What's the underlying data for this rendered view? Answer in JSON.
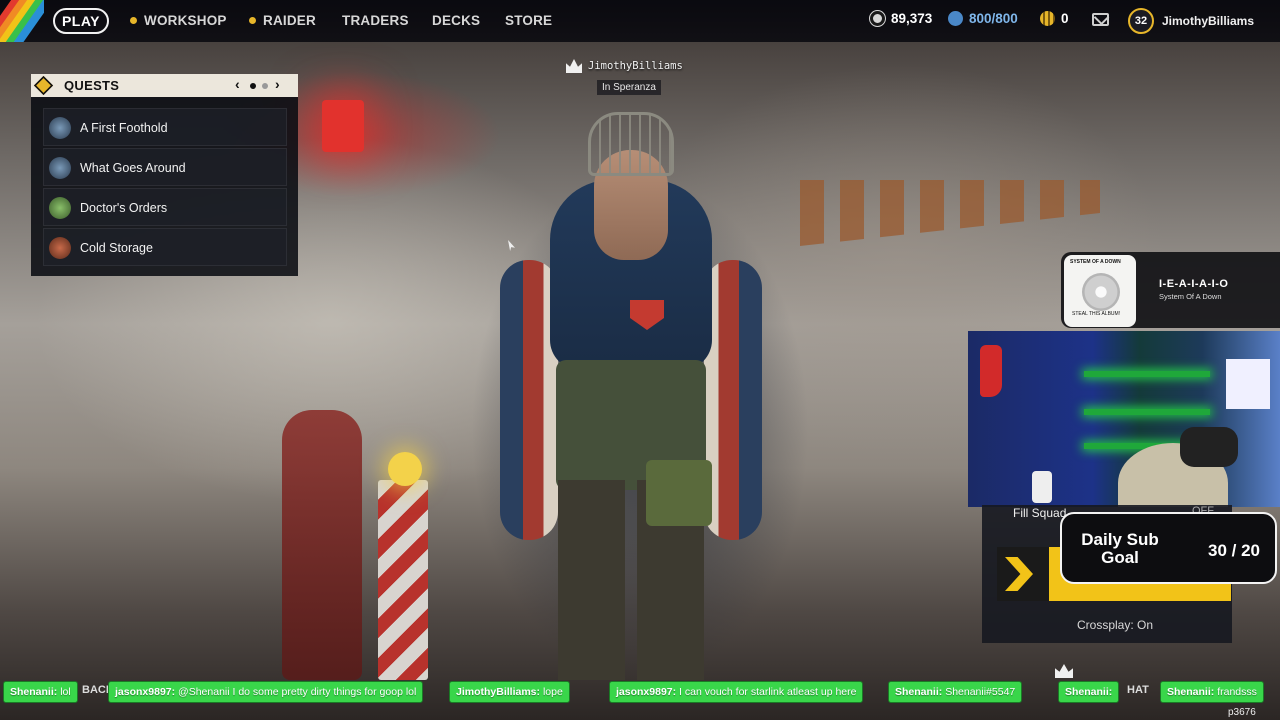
{
  "nav": {
    "play": "PLAY",
    "items": [
      "WORKSHOP",
      "RAIDER",
      "TRADERS",
      "DECKS",
      "STORE"
    ],
    "currency_coins": "89,373",
    "currency_raider": "800/800",
    "currency_tokens": "0",
    "level": "32",
    "username": "JimothyBilliams"
  },
  "quests": {
    "title": "QUESTS",
    "pager_prev": "‹",
    "pager_next": "›",
    "items": [
      {
        "label": "A First Foothold"
      },
      {
        "label": "What Goes Around"
      },
      {
        "label": "Doctor's Orders"
      },
      {
        "label": "Cold Storage"
      }
    ]
  },
  "player_tag": {
    "name": "JimothyBilliams",
    "location": "In Speranza"
  },
  "music": {
    "track": "I-E-A-I-A-I-O",
    "artist": "System Of A Down",
    "album_top": "SYSTEM OF A DOWN",
    "album_bottom": "STEAL THIS ALBUM!"
  },
  "squad": {
    "fill_label": "Fill Squad",
    "fill_state": "OFF",
    "crossplay": "Crossplay: On"
  },
  "sub_goal": {
    "title": "Daily Sub Goal",
    "count": "30 / 20"
  },
  "chat": [
    {
      "user": "Shenanii:",
      "msg": "lol"
    },
    {
      "user": "jasonx9897:",
      "msg": "@Shenanii I do some pretty dirty things for goop lol"
    },
    {
      "user": "JimothyBilliams:",
      "msg": "lope"
    },
    {
      "user": "jasonx9897:",
      "msg": "I can vouch for starlink atleast up here"
    },
    {
      "user": "Shenanii:",
      "msg": "Shenanii#5547"
    },
    {
      "user": "Shenanii:",
      "msg": ""
    },
    {
      "user": "Shenanii:",
      "msg": "frandsss"
    }
  ],
  "chat_ghost_left": "BACK",
  "chat_ghost_right": "HAT",
  "footer_code": "p3676",
  "colors": {
    "accent_yellow": "#f2c318",
    "chat_green": "#39d64a",
    "quest_header": "#ece7dc"
  }
}
